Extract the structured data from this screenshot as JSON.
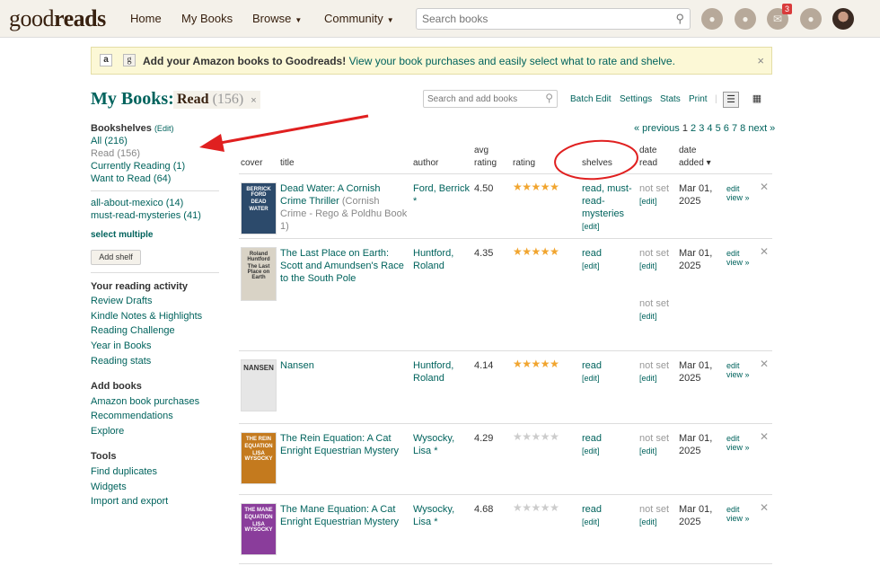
{
  "header": {
    "logo_light": "good",
    "logo_bold": "reads",
    "nav": [
      "Home",
      "My Books",
      "Browse",
      "Community"
    ],
    "search_placeholder": "Search books",
    "mail_count": "3"
  },
  "promo": {
    "amazon_letter": "a",
    "g_letter": "g",
    "bold": "Add your Amazon books to Goodreads!",
    "link": "View your book purchases and easily select what to rate and shelve.",
    "close": "×"
  },
  "page": {
    "title": "My Books:",
    "shelf_name": "Read",
    "shelf_count": "(156)",
    "shelf_remove": "×",
    "add_search_placeholder": "Search and add books",
    "tools": [
      "Batch Edit",
      "Settings",
      "Stats",
      "Print"
    ],
    "pager": {
      "prev": "« previous",
      "pages": [
        "1",
        "2",
        "3",
        "4",
        "5",
        "6",
        "7",
        "8"
      ],
      "next": "next »"
    }
  },
  "sidebar": {
    "bookshelves_title": "Bookshelves",
    "bookshelves_edit": "(Edit)",
    "shelves": [
      "All (216)",
      "Read (156)",
      "Currently Reading (1)",
      "Want to Read (64)"
    ],
    "custom_shelves": [
      "all-about-mexico (14)",
      "must-read-mysteries (41)"
    ],
    "select_multiple": "select multiple",
    "add_shelf": "Add shelf",
    "activity_title": "Your reading activity",
    "activity": [
      "Review Drafts",
      "Kindle Notes & Highlights",
      "Reading Challenge",
      "Year in Books",
      "Reading stats"
    ],
    "addbooks_title": "Add books",
    "addbooks": [
      "Amazon book purchases",
      "Recommendations",
      "Explore"
    ],
    "tools_title": "Tools",
    "tools": [
      "Find duplicates",
      "Widgets",
      "Import and export"
    ]
  },
  "table": {
    "headers": {
      "cover": "cover",
      "title": "title",
      "author": "author",
      "avg1": "avg",
      "avg2": "rating",
      "rating": "rating",
      "shelves": "shelves",
      "dr1": "date",
      "dr2": "read",
      "da1": "date",
      "da2": "added ▾"
    },
    "rows": [
      {
        "title": "Dead Water: A Cornish Crime Thriller",
        "series": "(Cornish Crime - Rego & Poldhu Book 1)",
        "author": "Ford, Berrick *",
        "avg": "4.50",
        "stars": 5,
        "shelves": "read, must-read-mysteries",
        "shelves_edit": "[edit]",
        "date_read": "not set",
        "date_read_edit": "[edit]",
        "date_added": "Mar 01, 2025",
        "edit": "edit",
        "view": "view »",
        "cover_text": [
          "BERRICK FORD",
          "DEAD",
          "WATER"
        ],
        "cover_color": "#2c4a6b"
      },
      {
        "title": "The Last Place on Earth: Scott and Amundsen's Race to the South Pole",
        "series": "",
        "author": "Huntford, Roland",
        "avg": "4.35",
        "stars": 5,
        "shelves": "read",
        "shelves_edit": "[edit]",
        "date_read": "not set",
        "date_read_edit": "[edit]",
        "date_read2": "not set",
        "date_read2_edit": "[edit]",
        "date_added": "Mar 01, 2025",
        "edit": "edit",
        "view": "view »",
        "cover_text": [
          "Roland Huntford",
          "The Last Place on Earth"
        ],
        "cover_color": "#d9d3c6"
      },
      {
        "title": "Nansen",
        "series": "",
        "author": "Huntford, Roland",
        "avg": "4.14",
        "stars": 5,
        "shelves": "read",
        "shelves_edit": "[edit]",
        "date_read": "not set",
        "date_read_edit": "[edit]",
        "date_added": "Mar 01, 2025",
        "edit": "edit",
        "view": "view »",
        "cover_text": [
          "NANSEN"
        ],
        "cover_color": "#e6e6e6"
      },
      {
        "title": "The Rein Equation: A Cat Enright Equestrian Mystery",
        "series": "",
        "author": "Wysocky, Lisa *",
        "avg": "4.29",
        "stars": 0,
        "shelves": "read",
        "shelves_edit": "[edit]",
        "date_read": "not set",
        "date_read_edit": "[edit]",
        "date_added": "Mar 01, 2025",
        "edit": "edit",
        "view": "view »",
        "cover_text": [
          "THE REIN",
          "EQUATION",
          "LISA WYSOCKY"
        ],
        "cover_color": "#c47a1e"
      },
      {
        "title": "The Mane Equation: A Cat Enright Equestrian Mystery",
        "series": "",
        "author": "Wysocky, Lisa *",
        "avg": "4.68",
        "stars": 0,
        "shelves": "read",
        "shelves_edit": "[edit]",
        "date_read": "not set",
        "date_read_edit": "[edit]",
        "date_added": "Mar 01, 2025",
        "edit": "edit",
        "view": "view »",
        "cover_text": [
          "THE MANE",
          "EQUATION",
          "LISA WYSOCKY"
        ],
        "cover_color": "#8a3d9b"
      }
    ]
  },
  "colors": {
    "link": "#00635d",
    "star": "#f1a52f",
    "star_empty": "#ccc",
    "annotation": "#e02020"
  }
}
